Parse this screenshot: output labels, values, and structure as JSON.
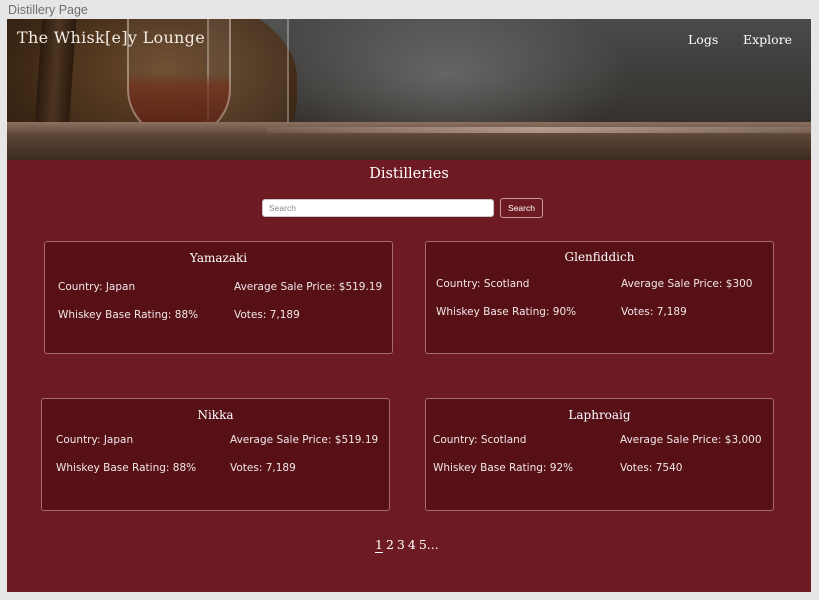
{
  "frame_label": "Distillery Page",
  "header": {
    "brand": "The Whisk[e]y Lounge",
    "nav": [
      "Logs",
      "Explore"
    ]
  },
  "main": {
    "title": "Distilleries",
    "search": {
      "placeholder": "Search",
      "button_label": "Search"
    },
    "distilleries": [
      {
        "name": "Yamazaki",
        "country": "Country: Japan",
        "price": "Average Sale Price: $519.19",
        "rating": "Whiskey Base Rating: 88%",
        "votes": "Votes: 7,189"
      },
      {
        "name": "Glenfiddich",
        "country": "Country: Scotland",
        "price": "Average Sale Price: $300",
        "rating": "Whiskey Base Rating: 90%",
        "votes": "Votes: 7,189"
      },
      {
        "name": "Nikka",
        "country": "Country: Japan",
        "price": "Average Sale Price: $519.19",
        "rating": "Whiskey Base Rating: 88%",
        "votes": "Votes: 7,189"
      },
      {
        "name": "Laphroaig",
        "country": "Country: Scotland",
        "price": "Average Sale Price: $3,000",
        "rating": "Whiskey Base Rating: 92%",
        "votes": "Votes: 7540"
      }
    ],
    "pagination": {
      "pages": [
        "1",
        "2",
        "3",
        "4",
        "5..."
      ],
      "active_page": "1"
    }
  },
  "colors": {
    "page_background": "#6e1a22",
    "card_background": "#561016",
    "card_border": "#a56b72",
    "canvas_background": "#e6e6e6"
  }
}
